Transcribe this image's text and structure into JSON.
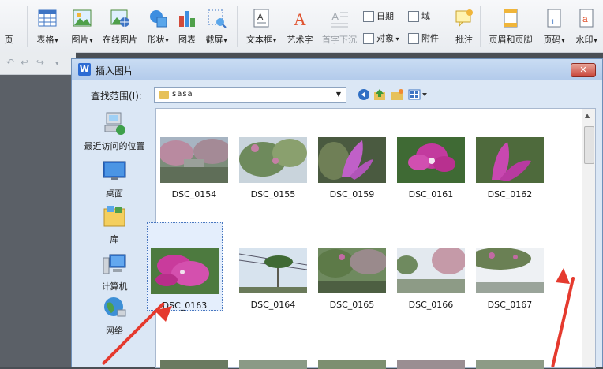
{
  "ribbon": {
    "partial_left": "页",
    "items": [
      {
        "label": "表格",
        "icon": "table-icon",
        "dropdown": true
      },
      {
        "label": "图片",
        "icon": "picture-icon",
        "dropdown": true
      },
      {
        "label": "在线图片",
        "icon": "online-picture-icon",
        "dropdown": false
      },
      {
        "label": "形状",
        "icon": "shapes-icon",
        "dropdown": true
      },
      {
        "label": "图表",
        "icon": "chart-icon",
        "dropdown": false
      },
      {
        "label": "截屏",
        "icon": "screenshot-icon",
        "dropdown": true
      },
      {
        "label": "文本框",
        "icon": "textbox-icon",
        "dropdown": true
      },
      {
        "label": "艺术字",
        "icon": "wordart-icon",
        "dropdown": false
      },
      {
        "label": "首字下沉",
        "icon": "dropcap-icon",
        "dropdown": false,
        "disabled": true
      },
      {
        "label": "批注",
        "icon": "comment-icon",
        "dropdown": false
      },
      {
        "label": "页眉和页脚",
        "icon": "header-footer-icon",
        "dropdown": false
      },
      {
        "label": "页码",
        "icon": "page-number-icon",
        "dropdown": true
      },
      {
        "label": "水印",
        "icon": "watermark-icon",
        "dropdown": true
      }
    ],
    "small": {
      "date": "日期",
      "field": "域",
      "object": "对象",
      "attachment": "附件"
    }
  },
  "dialog": {
    "title": "插入图片",
    "close": "✕",
    "look_in_label": "查找范围(I):",
    "look_in_value": "sasa",
    "places": [
      {
        "label": "最近访问的位置",
        "icon": "recent-places-icon"
      },
      {
        "label": "桌面",
        "icon": "desktop-icon"
      },
      {
        "label": "库",
        "icon": "libraries-icon"
      },
      {
        "label": "计算机",
        "icon": "computer-icon"
      },
      {
        "label": "网络",
        "icon": "network-icon"
      }
    ],
    "files": [
      {
        "name": "DSC_0154"
      },
      {
        "name": "DSC_0155"
      },
      {
        "name": "DSC_0159"
      },
      {
        "name": "DSC_0161"
      },
      {
        "name": "DSC_0162"
      },
      {
        "name": "DSC_0163",
        "selected": true
      },
      {
        "name": "DSC_0164"
      },
      {
        "name": "DSC_0165"
      },
      {
        "name": "DSC_0166"
      },
      {
        "name": "DSC_0167"
      }
    ]
  },
  "colors": {
    "accent": "#2d6bd3",
    "annotation_arrow": "#e53a2e",
    "dialog_bg": "#dbe7f5"
  }
}
